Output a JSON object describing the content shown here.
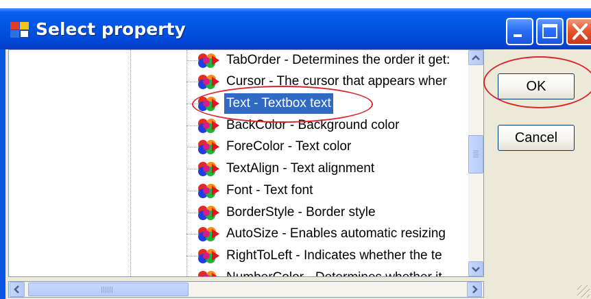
{
  "window": {
    "title": "Select property"
  },
  "items": [
    {
      "label": "TabOrder - Determines the order it get:",
      "selected": false
    },
    {
      "label": "Cursor - The cursor that appears wher",
      "selected": false
    },
    {
      "label": "Text - Textbox text",
      "selected": true
    },
    {
      "label": "BackColor - Background color",
      "selected": false
    },
    {
      "label": "ForeColor - Text color",
      "selected": false
    },
    {
      "label": "TextAlign - Text alignment",
      "selected": false
    },
    {
      "label": "Font - Text font",
      "selected": false
    },
    {
      "label": "BorderStyle - Border style",
      "selected": false
    },
    {
      "label": "AutoSize - Enables automatic resizing",
      "selected": false
    },
    {
      "label": "RightToLeft - Indicates whether the te",
      "selected": false
    },
    {
      "label": "NumberColor - Determines whether it",
      "selected": false
    }
  ],
  "buttons": {
    "ok": "OK",
    "cancel": "Cancel"
  },
  "icons": {
    "app": "application-icon",
    "property": "property-icon",
    "minimize": "minimize-icon",
    "maximize": "maximize-icon",
    "close": "close-icon",
    "scroll_up": "chevron-up-icon",
    "scroll_down": "chevron-down-icon",
    "scroll_left": "chevron-left-icon",
    "scroll_right": "chevron-right-icon"
  },
  "colors": {
    "titlebar": "#0054e3",
    "selection": "#316ac5",
    "annotation": "#d8282f",
    "close_button": "#e2572f"
  }
}
